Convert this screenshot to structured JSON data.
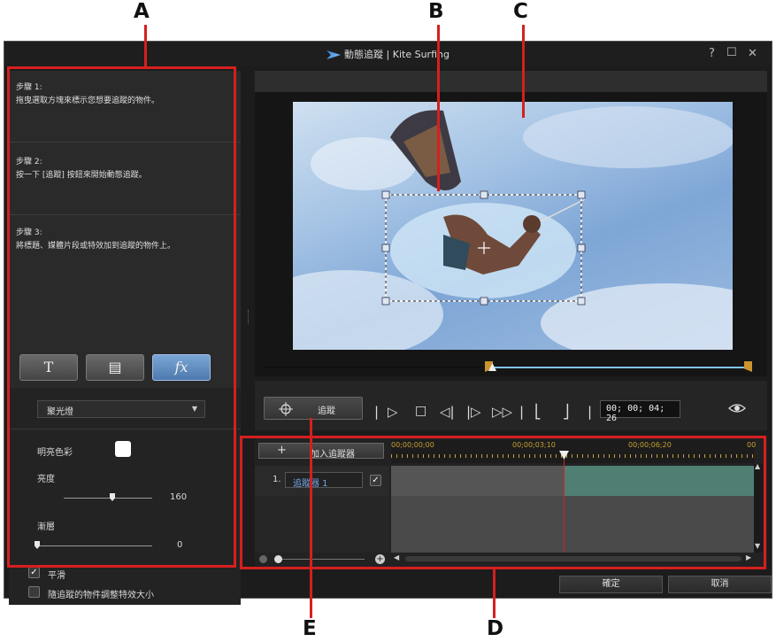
{
  "window": {
    "title": "動態追蹤 | Kite Surfing",
    "help": "?",
    "maximize": "☐",
    "close": "✕"
  },
  "callouts": {
    "a": "A",
    "b": "B",
    "c": "C",
    "d": "D",
    "e": "E"
  },
  "steps": [
    {
      "heading": "步驟 1:",
      "text": "拖曳選取方塊來標示您想要追蹤的物件。"
    },
    {
      "heading": "步驟 2:",
      "text": "按一下 [追蹤] 按鈕來開始動態追蹤。"
    },
    {
      "heading": "步驟 3:",
      "text": "將標題、媒體片段或特效加到追蹤的物件上。"
    }
  ],
  "effect_buttons": {
    "title": "T",
    "media": "▤",
    "fx": "fx"
  },
  "effect_select": {
    "value": "聚光燈"
  },
  "options": {
    "highlight_color_label": "明亮色彩",
    "highlight_color": "#ffffff",
    "brightness_label": "亮度",
    "brightness_value": "160",
    "brightness_fraction": 0.55,
    "feather_label": "漸層",
    "feather_value": "0",
    "feather_fraction": 0.0,
    "smooth_label": "平滑",
    "smooth_checked": true,
    "resize_label": "隨追蹤的物件調整特效大小",
    "resize_checked": false
  },
  "playback": {
    "track_button": "追蹤",
    "timecode": "00; 00; 04; 26"
  },
  "timeline": {
    "add_tracker": "加入追蹤器",
    "ruler": [
      "00;00;00;00",
      "00;00;03;10",
      "00;00;06;20",
      "00"
    ],
    "tracker_index": "1.",
    "tracker_name": "追蹤器 1",
    "tracker_checked": true
  },
  "footer": {
    "ok": "確定",
    "cancel": "取消"
  },
  "colors": {
    "accent_red": "#d61f1f",
    "tracker_green": "#4f7f73",
    "progress_blue": "#7fc4e8"
  }
}
